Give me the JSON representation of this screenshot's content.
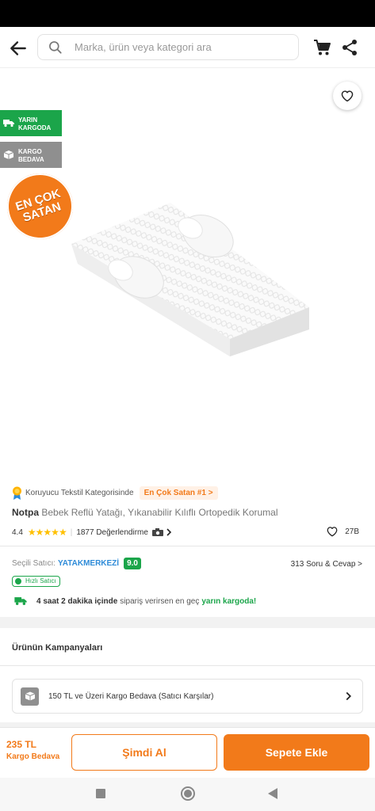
{
  "header": {
    "search_placeholder": "Marka, ürün veya kategori ara"
  },
  "gallery": {
    "tag_yarin_line1": "YARIN",
    "tag_yarin_line2": "KARGODA",
    "tag_kargo_line1": "KARGO",
    "tag_kargo_line2": "BEDAVA",
    "bestseller_line1": "EN ÇOK",
    "bestseller_line2": "SATAN"
  },
  "product": {
    "category_text": "Koruyucu Tekstil Kategorisinde",
    "rank_badge": "En Çok Satan #1 >",
    "brand": "Notpa",
    "title": "Bebek Reflü Yatağı, Yıkanabilir Kılıflı Ortopedik Korumal",
    "rating": "4.4",
    "stars": "★★★★★",
    "review_count": "1877 Değerlendirme",
    "favorite_count": "27B"
  },
  "seller": {
    "label": "Seçili Satıcı:",
    "name": "YATAKMERKEZİ",
    "score": "9.0",
    "qa_link": "313 Soru & Cevap >",
    "fast_seller": "Hızlı Satıcı",
    "delivery_bold": "4 saat 2 dakika içinde",
    "delivery_mid": "sipariş verirsen en geç",
    "delivery_green": "yarın kargoda!"
  },
  "campaigns": {
    "title": "Ürünün Kampanyaları",
    "item": "150 TL ve Üzeri Kargo Bedava (Satıcı Karşılar)"
  },
  "bottom": {
    "price": "235 TL",
    "shipping": "Kargo Bedava",
    "buy_now": "Şimdi Al",
    "add_to_cart": "Sepete Ekle"
  },
  "colors": {
    "accent": "#f27a1a",
    "green": "#1ba54a",
    "link": "#2e8bd8"
  }
}
